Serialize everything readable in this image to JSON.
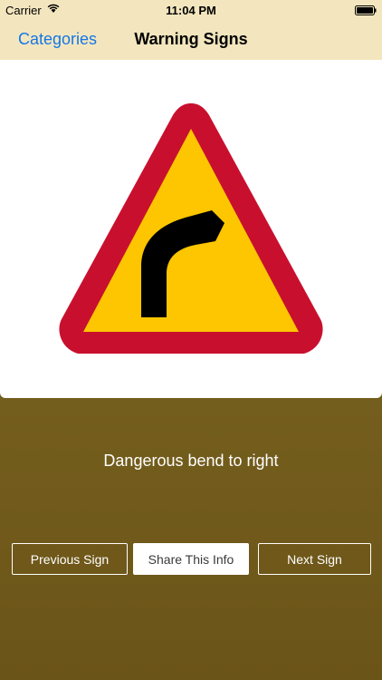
{
  "status_bar": {
    "carrier": "Carrier",
    "time": "11:04 PM",
    "wifi_icon": "wifi-icon",
    "battery_icon": "battery-icon"
  },
  "nav": {
    "back_label": "Categories",
    "title": "Warning Signs"
  },
  "sign": {
    "description": "Dangerous bend to right",
    "colors": {
      "border": "#c8102e",
      "fill": "#fdc600",
      "symbol": "#000000"
    }
  },
  "buttons": {
    "previous": "Previous Sign",
    "share": "Share This Info",
    "next": "Next Sign"
  },
  "colors": {
    "nav_background": "#f3e6be",
    "link": "#1577e6",
    "body_background": "#7a6420"
  }
}
